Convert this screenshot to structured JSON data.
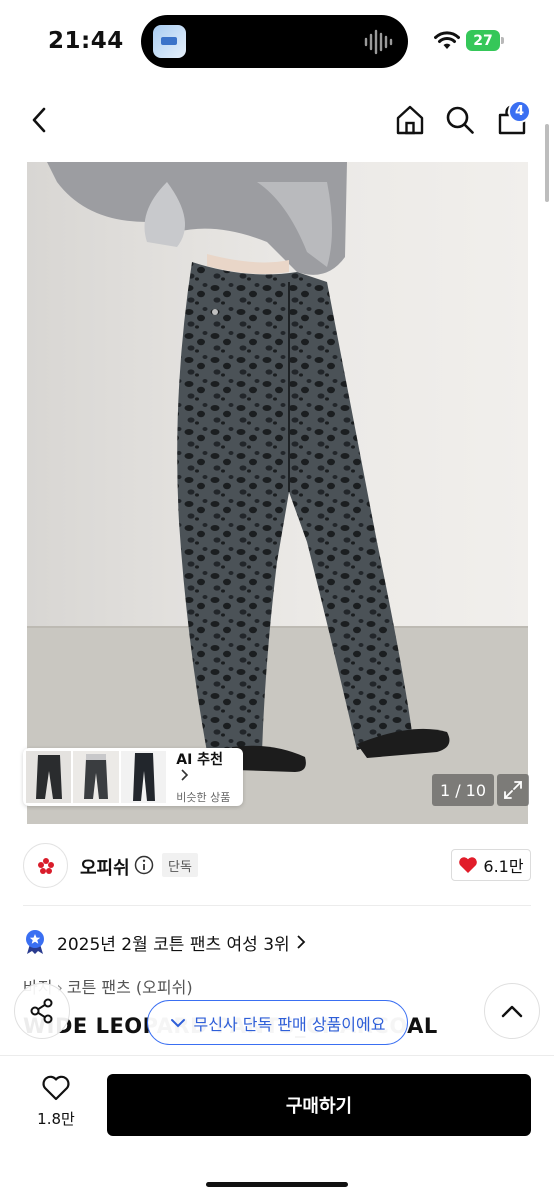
{
  "status_bar": {
    "time": "21:44",
    "battery": "27"
  },
  "nav": {
    "cart_count": "4"
  },
  "gallery": {
    "counter": "1 / 10",
    "ai_title": "AI 추천",
    "ai_subtitle": "비슷한 상품"
  },
  "brand": {
    "name": "오피쉬",
    "exclusive_tag": "단독",
    "like_count": "6.1만"
  },
  "ranking": {
    "text": "2025년 2월 코튼 팬츠 여성 3위"
  },
  "breadcrumb": {
    "items": [
      "바지",
      "코튼 팬츠 (오피쉬)"
    ]
  },
  "product": {
    "title": "WIDE LEOPARD PANTS_CHARCOAL"
  },
  "toast": {
    "text": "무신사 단독 판매 상품이에요"
  },
  "bottom": {
    "like_count": "1.8만",
    "buy_label": "구매하기"
  },
  "colors": {
    "accent": "#3a6ff2",
    "heart": "#e11d2a",
    "battery": "#35c759",
    "buy_button": "#000000"
  }
}
